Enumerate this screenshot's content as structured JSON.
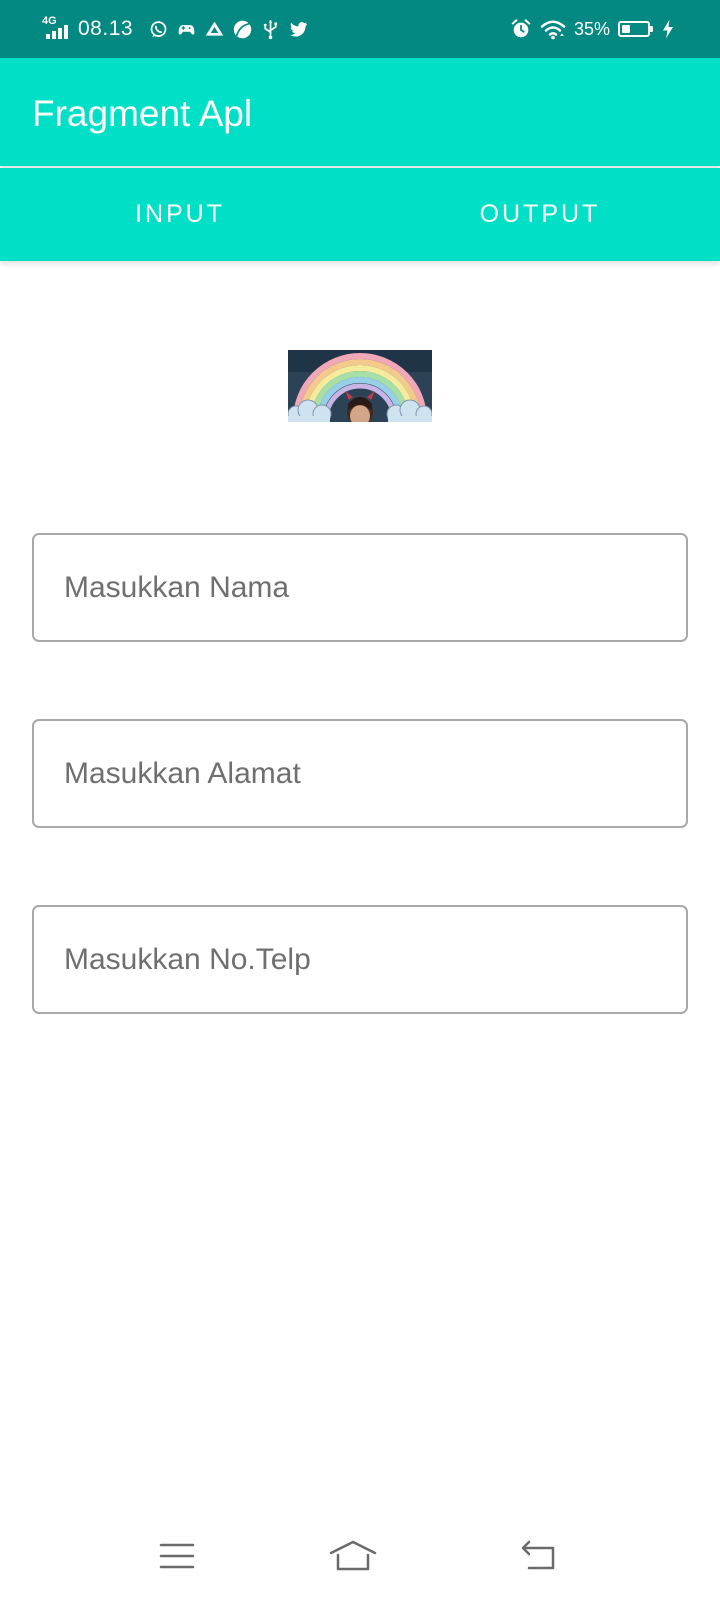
{
  "status_bar": {
    "network": "4G",
    "time": "08.13",
    "notification_icons": [
      "whatsapp-icon",
      "game-controller-icon",
      "drive-icon",
      "leaf-app-icon",
      "usb-icon",
      "twitter-icon"
    ],
    "battery_percent": "35%",
    "battery_level": 0.35,
    "background": "#038882"
  },
  "app_bar": {
    "title": "Fragment Apl",
    "background": "#02dfc7"
  },
  "tabs": [
    {
      "label": "INPUT"
    },
    {
      "label": "OUTPUT"
    }
  ],
  "form": {
    "fields": [
      {
        "placeholder": "Masukkan Nama",
        "value": ""
      },
      {
        "placeholder": "Masukkan Alamat",
        "value": ""
      },
      {
        "placeholder": "Masukkan No.Telp",
        "value": ""
      }
    ]
  },
  "nav_bar": {
    "buttons": [
      "menu-icon",
      "home-icon",
      "back-icon"
    ]
  }
}
